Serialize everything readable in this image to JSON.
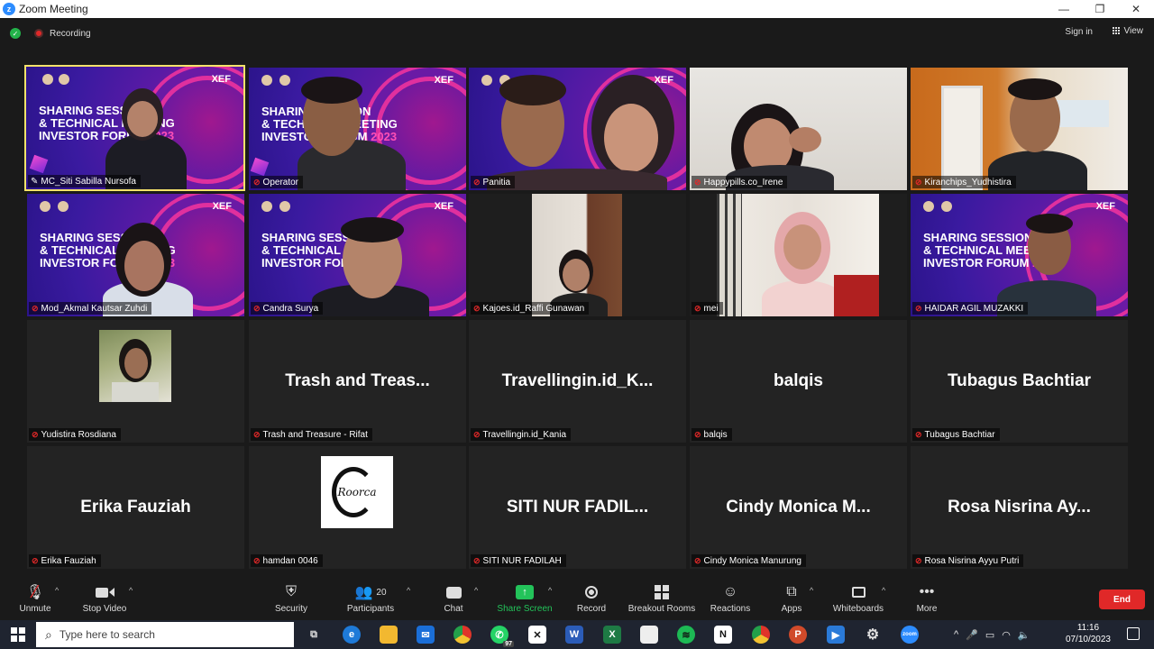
{
  "window": {
    "title": "Zoom Meeting",
    "controls": [
      "—",
      "❐",
      "✕"
    ]
  },
  "topbar": {
    "recording_label": "Recording",
    "signin_label": "Sign in",
    "view_label": "View"
  },
  "tiles": [
    {
      "name": "MC_Siti Sabilla Nursofa"
    },
    {
      "name": "Operator"
    },
    {
      "name": "Panitia"
    },
    {
      "name": "Happypills.co_Irene"
    },
    {
      "name": "Kiranchips_Yudhistira"
    },
    {
      "name": "Mod_Akmal Kautsar Zuhdi"
    },
    {
      "name": "Candra Surya"
    },
    {
      "name": "Kajoes.id_Raffi Gunawan"
    },
    {
      "name": "mei"
    },
    {
      "name": "HAIDAR AGIL MUZAKKI"
    },
    {
      "name": "Yudistira Rosdiana"
    },
    {
      "name": "Trash and Treasure - Rifat",
      "display": "Trash  and  Treas..."
    },
    {
      "name": "Travellingin.id_Kania",
      "display": "Travellingin.id_K..."
    },
    {
      "name": "balqis",
      "display": "balqis"
    },
    {
      "name": "Tubagus Bachtiar",
      "display": "Tubagus  Bachtiar"
    },
    {
      "name": "Erika Fauziah",
      "display": "Erika  Fauziah"
    },
    {
      "name": "hamdan 0046",
      "avatar_text": "Roorca"
    },
    {
      "name": "SITI NUR FADILAH",
      "display": "SITI  NUR  FADIL..."
    },
    {
      "name": "Cindy Monica Manurung",
      "display": "Cindy  Monica  M..."
    },
    {
      "name": "Rosa Nisrina Ayyu Putri",
      "display": "Rosa  Nisrina  Ay..."
    }
  ],
  "banner": {
    "line1": "SHARING SESSION",
    "line2": "& TECHNICAL MEETING",
    "line3": "INVESTOR FORUM",
    "year": "2023",
    "brand": "XEF"
  },
  "toolbar": {
    "unmute": "Unmute",
    "stop_video": "Stop Video",
    "security": "Security",
    "participants": "Participants",
    "participants_count": "20",
    "chat": "Chat",
    "share_screen": "Share Screen",
    "record": "Record",
    "breakout": "Breakout Rooms",
    "reactions": "Reactions",
    "apps": "Apps",
    "whiteboards": "Whiteboards",
    "more": "More",
    "end": "End"
  },
  "taskbar": {
    "search_placeholder": "Type here to search",
    "time": "11:16",
    "date": "07/10/2023",
    "whatsapp_badge": "97"
  },
  "colors": {
    "accent_share": "#23c35a",
    "end_red": "#e02828",
    "active_speaker": "#f4e26a"
  }
}
